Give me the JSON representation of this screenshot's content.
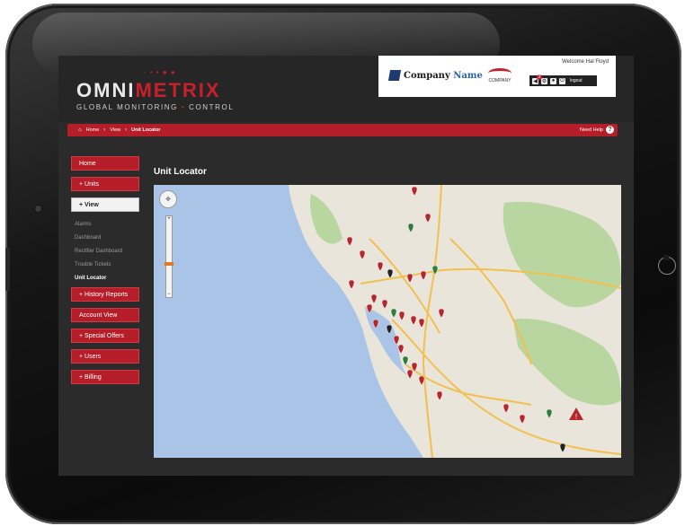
{
  "brand": {
    "logo_main_plain": "OMNI",
    "logo_main_accent": "METRIX",
    "logo_sub_1": "GLOBAL MONITORING",
    "logo_sub_dot": "•",
    "logo_sub_2": "CONTROL",
    "company_name_prefix": "Company",
    "company_name_suffix": "Name",
    "company2_label": "COMPANY"
  },
  "header": {
    "welcome": "Welcome Hal Floyd",
    "notification_count": "3",
    "logout_label": "logout"
  },
  "breadcrumb": {
    "home": "Home",
    "separator": "›",
    "view": "View",
    "current": "Unit Locator",
    "need_help": "Need Help",
    "help_glyph": "?"
  },
  "sidebar": {
    "home": "Home",
    "units": "+ Units",
    "view": "+ View",
    "sub": [
      "Alarms",
      "Dashboard",
      "Rectifier Dashboard",
      "Trouble Tickets",
      "Unit Locator"
    ],
    "history": "+ History Reports",
    "account": "Account View",
    "offers": "+ Special Offers",
    "users": "+ Users",
    "billing": "+ Billing"
  },
  "main": {
    "title": "Unit Locator"
  },
  "map": {
    "zoom_in": "+",
    "zoom_out": "−",
    "pan_glyph": "✥",
    "zoom_level": 0.62,
    "colors": {
      "water": "#a9c4e6",
      "land": "#e9e5da",
      "park": "#b9d5a0",
      "highway": "#f2c04e",
      "marker_red": "#b5262d",
      "marker_green": "#2f7d3a",
      "marker_black": "#222222"
    },
    "markers": [
      {
        "color": "red"
      },
      {
        "color": "red"
      },
      {
        "color": "red"
      },
      {
        "color": "green"
      },
      {
        "color": "red"
      },
      {
        "color": "red"
      },
      {
        "color": "black"
      },
      {
        "color": "red"
      },
      {
        "color": "red"
      },
      {
        "color": "green"
      },
      {
        "color": "red"
      },
      {
        "color": "red"
      },
      {
        "color": "red"
      },
      {
        "color": "red"
      },
      {
        "color": "green"
      },
      {
        "color": "red"
      },
      {
        "color": "red"
      },
      {
        "color": "red"
      },
      {
        "color": "red"
      },
      {
        "color": "black"
      },
      {
        "color": "red"
      },
      {
        "color": "red"
      },
      {
        "color": "green"
      },
      {
        "color": "red"
      },
      {
        "color": "red"
      },
      {
        "color": "red"
      },
      {
        "color": "red"
      },
      {
        "color": "red"
      },
      {
        "color": "red"
      },
      {
        "color": "green"
      },
      {
        "color": "red"
      },
      {
        "color": "black"
      }
    ]
  },
  "icons": {
    "home": "home-icon",
    "help": "help-icon",
    "alert": "alert-triangle-icon",
    "speaker": "speaker-icon",
    "gear": "gear-icon",
    "user": "user-icon",
    "power": "power-icon"
  }
}
